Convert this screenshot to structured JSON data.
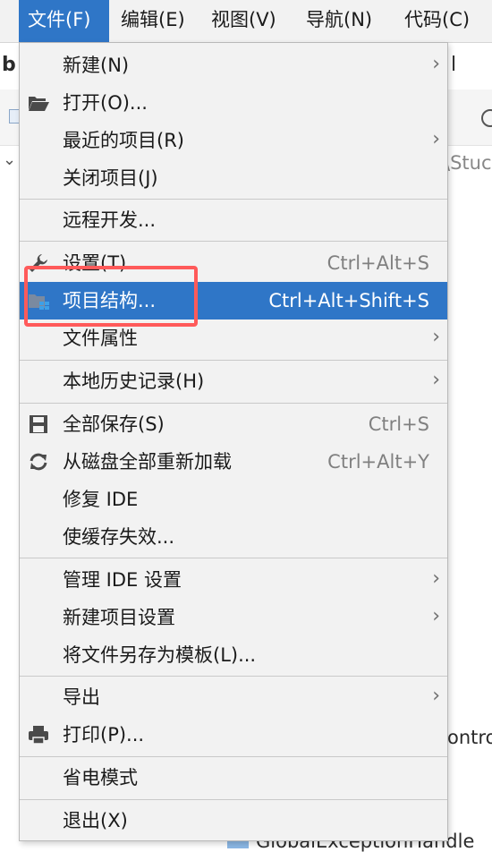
{
  "menubar": {
    "items": [
      {
        "label": "文件(F)",
        "active": true
      },
      {
        "label": "编辑(E)",
        "active": false
      },
      {
        "label": "视图(V)",
        "active": false
      },
      {
        "label": "导航(N)",
        "active": false
      },
      {
        "label": "代码(C)",
        "active": false
      }
    ]
  },
  "background": {
    "tab_left": "b",
    "tab_right": "l",
    "path_fragment": "\\Stuc",
    "tree_fragment": "ontro",
    "bottom_fragment": "GlobalExceptionHandle"
  },
  "file_menu": {
    "items": [
      {
        "label": "新建(N)",
        "shortcut": "",
        "submenu": true,
        "icon": ""
      },
      {
        "label": "打开(O)...",
        "shortcut": "",
        "submenu": false,
        "icon": "folder-open-icon"
      },
      {
        "label": "最近的项目(R)",
        "shortcut": "",
        "submenu": true,
        "icon": ""
      },
      {
        "label": "关闭项目(J)",
        "shortcut": "",
        "submenu": false,
        "icon": ""
      },
      {
        "label": "远程开发...",
        "shortcut": "",
        "submenu": false,
        "icon": ""
      },
      {
        "label": "设置(T)...",
        "shortcut": "Ctrl+Alt+S",
        "submenu": false,
        "icon": "wrench-icon"
      },
      {
        "label": "项目结构...",
        "shortcut": "Ctrl+Alt+Shift+S",
        "submenu": false,
        "icon": "project-structure-icon",
        "highlighted": true
      },
      {
        "label": "文件属性",
        "shortcut": "",
        "submenu": true,
        "icon": ""
      },
      {
        "label": "本地历史记录(H)",
        "shortcut": "",
        "submenu": true,
        "icon": ""
      },
      {
        "label": "全部保存(S)",
        "shortcut": "Ctrl+S",
        "submenu": false,
        "icon": "save-icon"
      },
      {
        "label": "从磁盘全部重新加载",
        "shortcut": "Ctrl+Alt+Y",
        "submenu": false,
        "icon": "reload-icon"
      },
      {
        "label": "修复 IDE",
        "shortcut": "",
        "submenu": false,
        "icon": ""
      },
      {
        "label": "使缓存失效...",
        "shortcut": "",
        "submenu": false,
        "icon": ""
      },
      {
        "label": "管理 IDE 设置",
        "shortcut": "",
        "submenu": true,
        "icon": ""
      },
      {
        "label": "新建项目设置",
        "shortcut": "",
        "submenu": true,
        "icon": ""
      },
      {
        "label": "将文件另存为模板(L)...",
        "shortcut": "",
        "submenu": false,
        "icon": ""
      },
      {
        "label": "导出",
        "shortcut": "",
        "submenu": true,
        "icon": ""
      },
      {
        "label": "打印(P)...",
        "shortcut": "",
        "submenu": false,
        "icon": "print-icon"
      },
      {
        "label": "省电模式",
        "shortcut": "",
        "submenu": false,
        "icon": ""
      },
      {
        "label": "退出(X)",
        "shortcut": "",
        "submenu": false,
        "icon": ""
      }
    ],
    "arrow_glyph": "›"
  },
  "colors": {
    "accent": "#2f76c7",
    "menu_bg": "#f2f2f2",
    "annotation_red": "#ff5a5a"
  }
}
